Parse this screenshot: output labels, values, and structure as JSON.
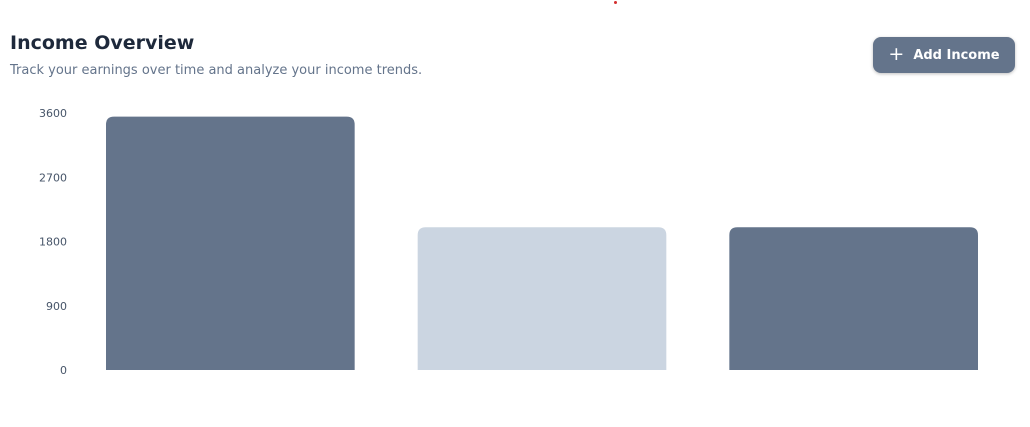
{
  "header": {
    "title": "Income Overview",
    "subtitle": "Track your earnings over time and analyze your income trends."
  },
  "actions": {
    "add_label": "Add Income",
    "add_icon": "plus-icon"
  },
  "colors": {
    "bar_dark": "#64748b",
    "bar_light": "#cbd5e1",
    "button": "#64748b",
    "title": "#1e293b",
    "subtitle": "#64748b",
    "indicator_dot": "#d32f2f"
  },
  "chart_data": {
    "type": "bar",
    "categories": [
      "",
      "",
      ""
    ],
    "values": [
      3550,
      2000,
      2000
    ],
    "bar_colors": [
      "#64748b",
      "#cbd5e1",
      "#64748b"
    ],
    "yticks": [
      0,
      900,
      1800,
      2700,
      3600
    ],
    "ylim": [
      0,
      3600
    ],
    "title": "",
    "xlabel": "",
    "ylabel": "",
    "grid": false,
    "legend": "none"
  }
}
